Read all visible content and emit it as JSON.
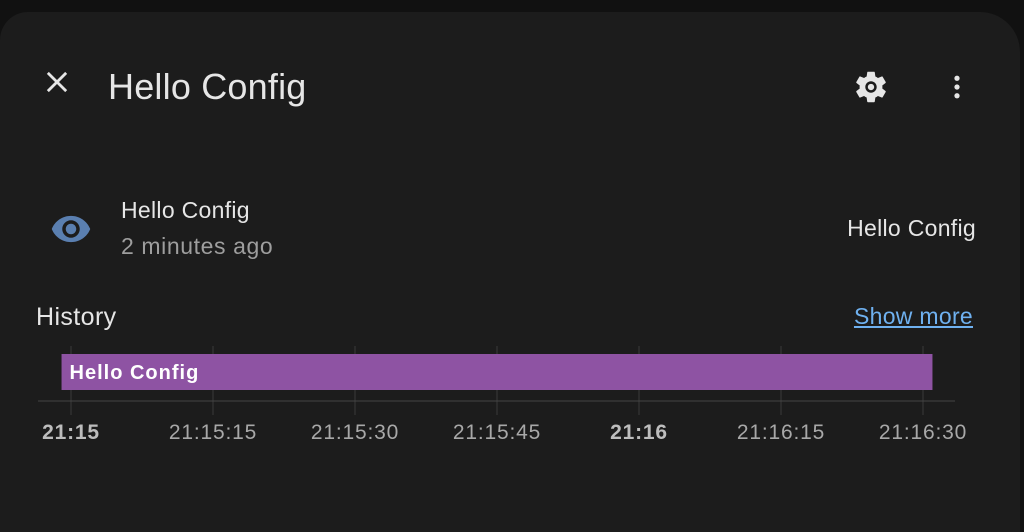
{
  "dialog": {
    "title": "Hello Config",
    "close_icon": "close-icon",
    "settings_icon": "gear-icon",
    "more_icon": "more-vertical-icon"
  },
  "entity": {
    "icon": "eye-icon",
    "icon_color": "#5a7fb0",
    "name": "Hello Config",
    "last_changed": "2 minutes ago",
    "state": "Hello Config"
  },
  "history": {
    "title": "History",
    "show_more_label": "Show more"
  },
  "chart_data": {
    "type": "timeline",
    "bar_color": "#8e53a3",
    "series": [
      {
        "label": "Hello Config",
        "start": "21:14:59",
        "end": "21:16:31"
      }
    ],
    "ticks": [
      {
        "label": "21:15",
        "bold": true
      },
      {
        "label": "21:15:15",
        "bold": false
      },
      {
        "label": "21:15:30",
        "bold": false
      },
      {
        "label": "21:15:45",
        "bold": false
      },
      {
        "label": "21:16",
        "bold": true
      },
      {
        "label": "21:16:15",
        "bold": false
      },
      {
        "label": "21:16:30",
        "bold": false
      }
    ],
    "grid": true
  }
}
